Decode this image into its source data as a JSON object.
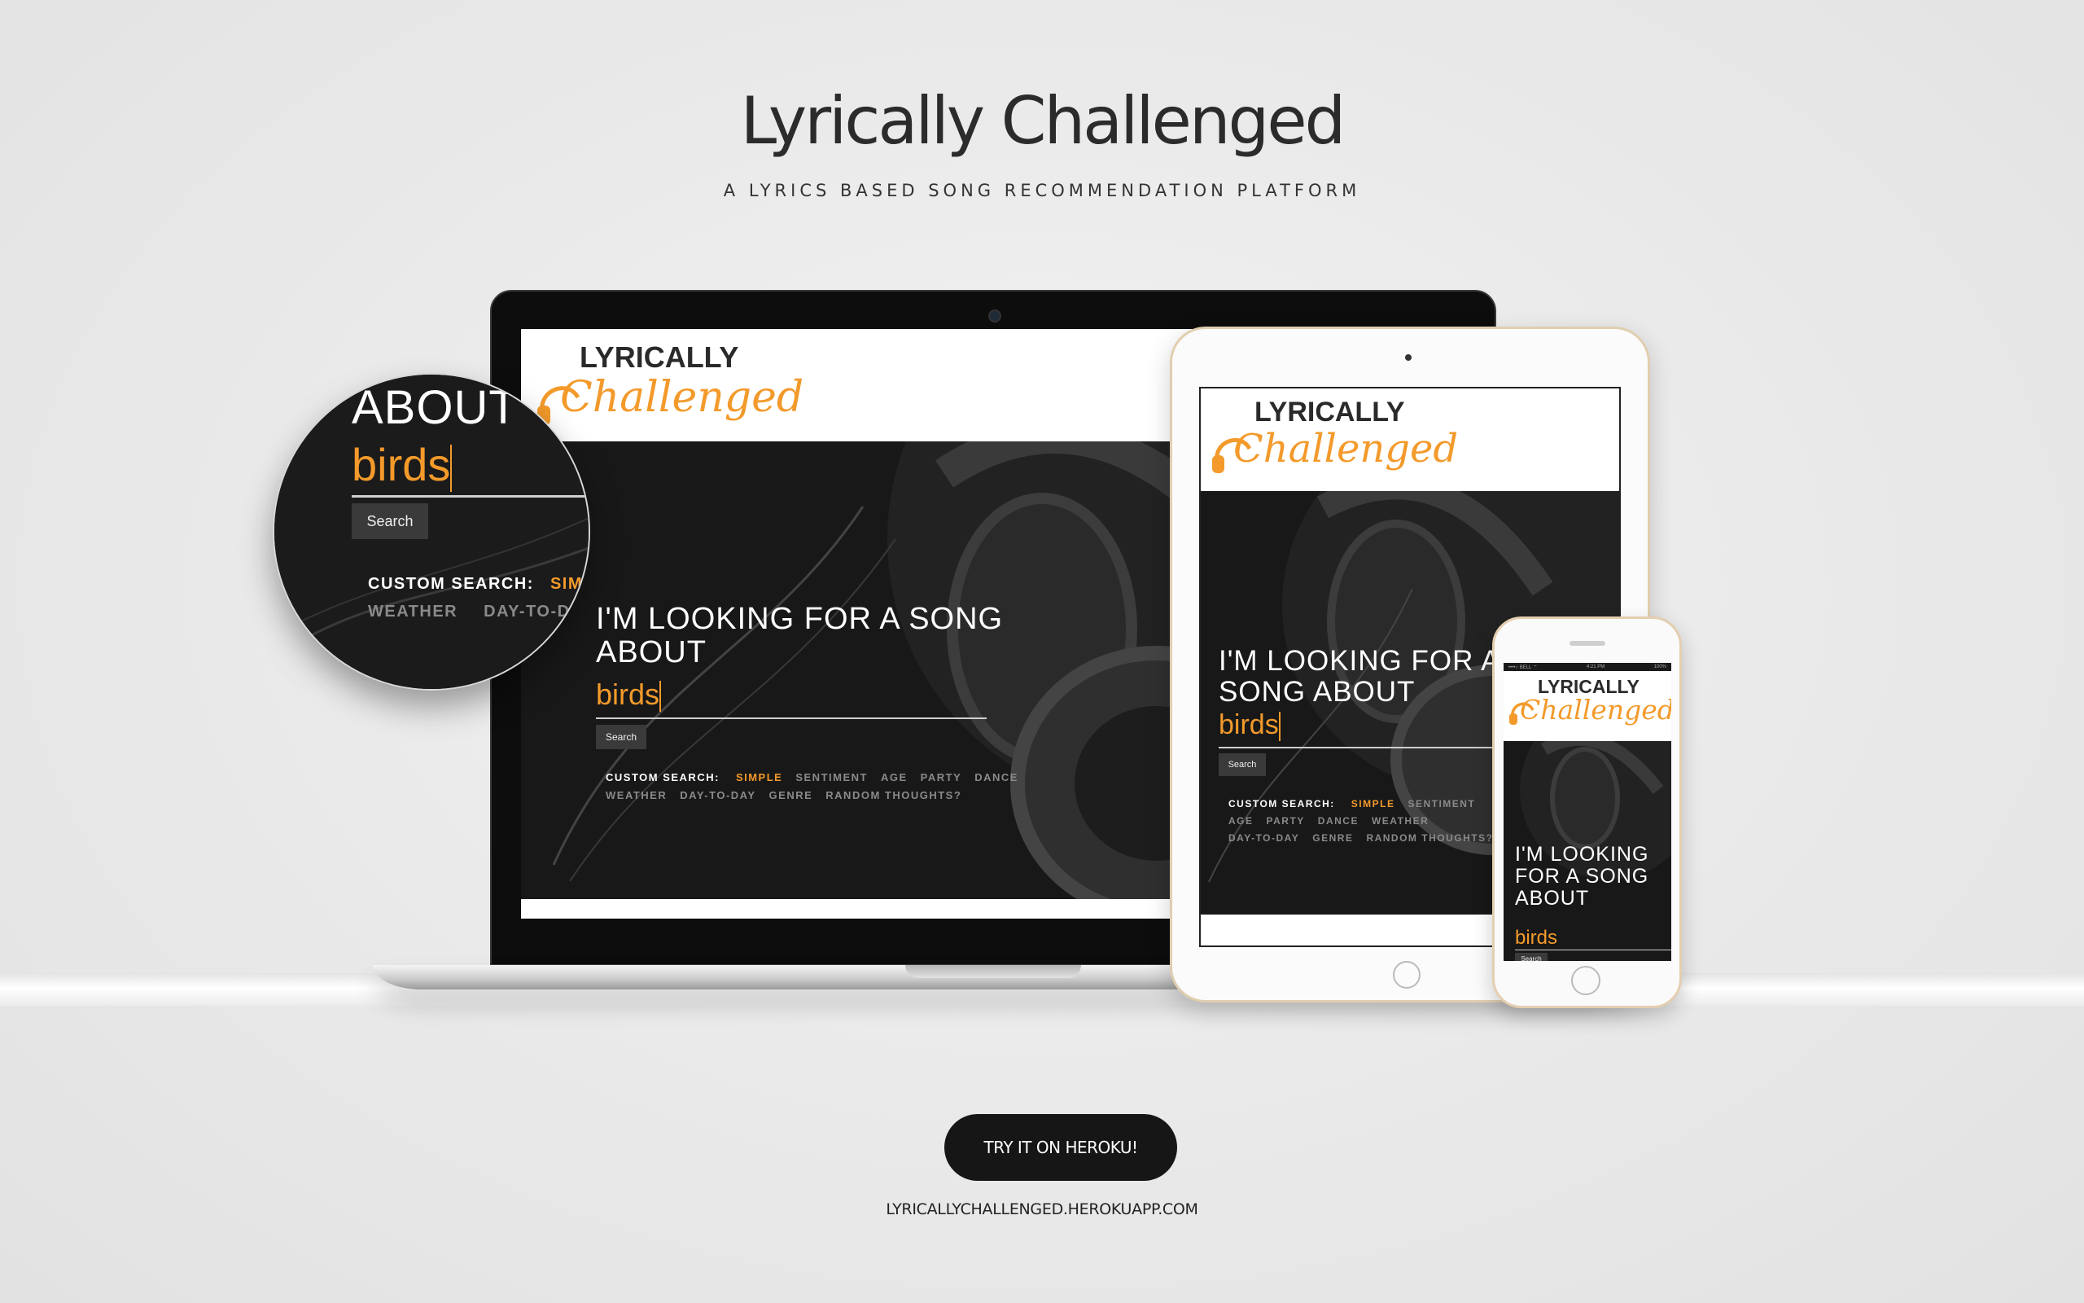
{
  "page": {
    "title": "Lyrically Challenged",
    "subtitle": "A LYRICS BASED SONG RECOMMENDATION PLATFORM",
    "cta_label": "TRY IT ON HEROKU!",
    "url": "LYRICALLYCHALLENGED.HEROKUAPP.COM"
  },
  "app": {
    "logo_top": "LYRICALLY",
    "logo_script": "Challenged",
    "headline": "I'M LOOKING FOR A SONG ABOUT",
    "query": "birds",
    "search_label": "Search",
    "custom_label": "CUSTOM SEARCH:",
    "options": [
      "SIMPLE",
      "SENTIMENT",
      "AGE",
      "PARTY",
      "DANCE",
      "WEATHER",
      "DAY-TO-DAY",
      "GENRE",
      "RANDOM THOUGHTS?"
    ],
    "active_option": "SIMPLE"
  },
  "zoom": {
    "headline_fragment": "ABOUT",
    "opt_fragment_1": "SIM",
    "opt_fragment_2": "DAY-TO-DA"
  },
  "phone_status": {
    "carrier": "••••○ BELL ⌔",
    "time": "4:21 PM",
    "battery": "100%"
  },
  "colors": {
    "accent": "#f39a2b",
    "dark": "#161616",
    "background": "#e9e9e9"
  }
}
